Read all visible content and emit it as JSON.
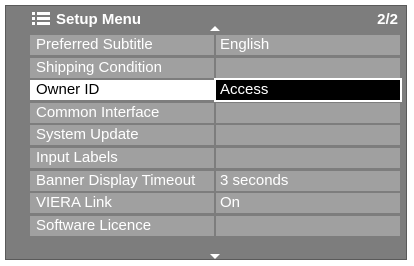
{
  "header": {
    "title": "Setup Menu",
    "page": "2/2",
    "icon": "list-menu-icon"
  },
  "colors": {
    "panel_bg": "#7d7d7d",
    "row_bg": "#a0a0a0",
    "selected_label_bg": "#ffffff",
    "selected_value_bg": "#000000"
  },
  "menu": {
    "items": [
      {
        "label": "Preferred Subtitle",
        "value": "English",
        "selected": false
      },
      {
        "label": "Shipping Condition",
        "value": "",
        "selected": false
      },
      {
        "label": "Owner ID",
        "value": "Access",
        "selected": true
      },
      {
        "label": "Common Interface",
        "value": "",
        "selected": false
      },
      {
        "label": "System Update",
        "value": "",
        "selected": false
      },
      {
        "label": "Input Labels",
        "value": "",
        "selected": false
      },
      {
        "label": "Banner Display Timeout",
        "value": "3 seconds",
        "selected": false
      },
      {
        "label": "VIERA Link",
        "value": "On",
        "selected": false
      },
      {
        "label": "Software Licence",
        "value": "",
        "selected": false
      }
    ]
  }
}
